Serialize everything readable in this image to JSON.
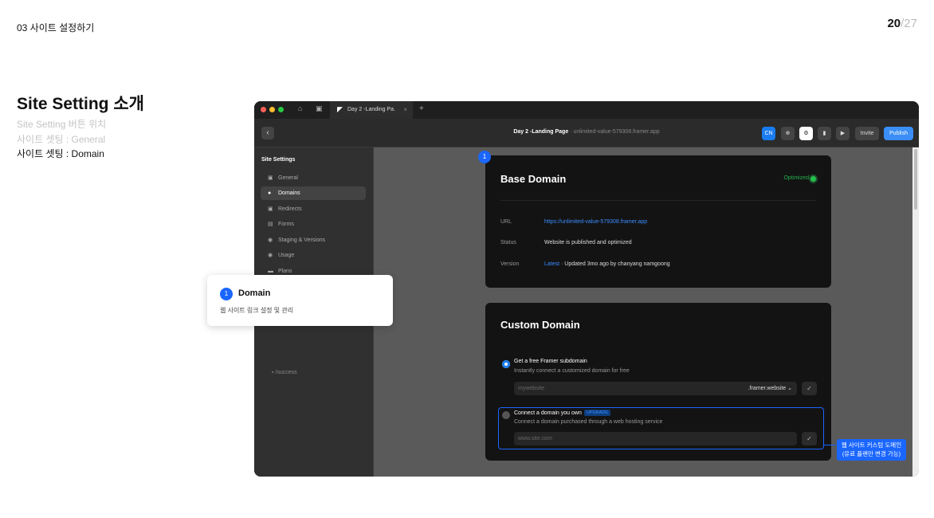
{
  "slide": {
    "section": "03  사이트 설정하기",
    "page_current": "20",
    "page_total": "/27",
    "heading": "Site Setting 소개",
    "steps": [
      "Site Setting 버튼 위치",
      "사이트 셋팅 : General",
      "사이트 셋팅 : Domain"
    ]
  },
  "browser": {
    "tab_title": "Day 2 -Landing Pa.",
    "doc_title": "Day 2 -Landing Page",
    "doc_sub": " · unlimited-value-579308.framer.app",
    "toolbar": {
      "avatar": "CN",
      "invite": "Invite",
      "publish": "Publish"
    },
    "sidebar": {
      "title": "Site Settings",
      "items": [
        "General",
        "Domains",
        "Redirects",
        "Forms",
        "Staging & Versions",
        "Usage",
        "Plans"
      ],
      "path_item": "/success"
    },
    "base_domain": {
      "title": "Base Domain",
      "status_badge": "Optimized",
      "url_label": "URL",
      "url_value": "https://unlimited-value-579308.framer.app",
      "status_label": "Status",
      "status_value": "Website is published and optimized",
      "version_label": "Version",
      "version_link": "Latest",
      "version_text": " · Updated 3mo ago by chanyang namgoong"
    },
    "custom_domain": {
      "title": "Custom Domain",
      "option1_title": "Get a free Framer subdomain",
      "option1_sub": "Instantly connect a customized domain for free",
      "option1_placeholder": "mywebsite",
      "option1_suffix": ".framer.website",
      "option2_title": "Connect a domain you own",
      "option2_badge": "UPGRADE",
      "option2_sub": "Connect a domain purchased through a web hosting service",
      "option2_placeholder": "www.site.com"
    }
  },
  "callout": {
    "number": "1",
    "title": "Domain",
    "description": "웹 사이트 링크 설정 및 관리"
  },
  "note": {
    "line1": "웹 사이트 커스텀 도메인",
    "line2": "(유료 플랜만 변경 가능)"
  },
  "colors": {
    "accent": "#1a66ff",
    "optimized": "#23c14d",
    "link": "#3b8cff"
  }
}
